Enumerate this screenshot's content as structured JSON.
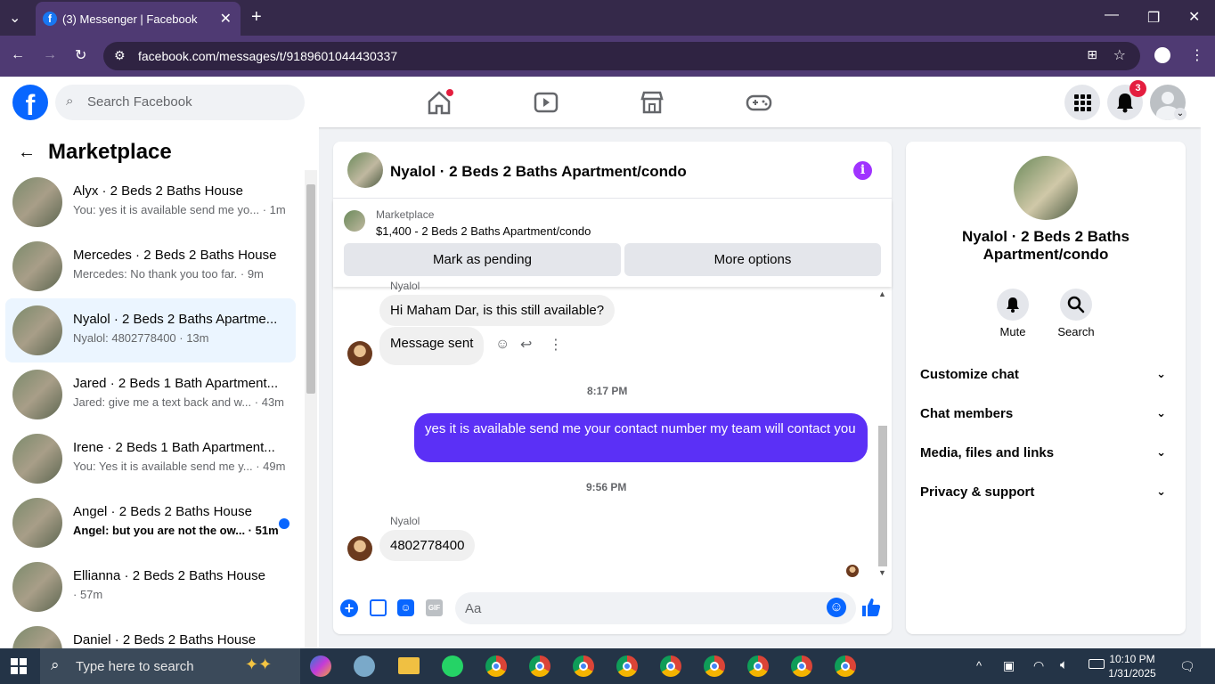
{
  "browser": {
    "tab_title": "(3) Messenger | Facebook",
    "url": "facebook.com/messages/t/9189601044430337"
  },
  "fb_header": {
    "search_placeholder": "Search Facebook",
    "notification_count": "3"
  },
  "sidebar": {
    "title": "Marketplace",
    "conversations": [
      {
        "name": "Alyx · 2 Beds 2 Baths House",
        "preview": "You: yes it is available send me yo... · 1m",
        "selected": false,
        "unread": false
      },
      {
        "name": "Mercedes · 2 Beds 2 Baths House",
        "preview": "Mercedes: No thank you too far. · 9m",
        "selected": false,
        "unread": false
      },
      {
        "name": "Nyalol · 2 Beds 2 Baths Apartme...",
        "preview": "Nyalol: 4802778400 · 13m",
        "selected": true,
        "unread": false
      },
      {
        "name": "Jared · 2 Beds 1 Bath Apartment...",
        "preview": "Jared: give me a text back and w... · 43m",
        "selected": false,
        "unread": false
      },
      {
        "name": "Irene · 2 Beds 1 Bath Apartment...",
        "preview": "You: Yes it is available send me y... · 49m",
        "selected": false,
        "unread": false
      },
      {
        "name": "Angel · 2 Beds 2 Baths House",
        "preview": "Angel: but you are not the ow... · 51m",
        "selected": false,
        "unread": true
      },
      {
        "name": "Ellianna · 2 Beds 2 Baths House",
        "preview": "· 57m",
        "selected": false,
        "unread": false
      },
      {
        "name": "Daniel · 2 Beds 2 Baths House",
        "preview": "",
        "selected": false,
        "unread": false
      }
    ]
  },
  "chat": {
    "title": "Nyalol · 2 Beds 2 Baths Apartment/condo",
    "marketplace_label": "Marketplace",
    "listing": "$1,400 - 2 Beds 2 Baths Apartment/condo",
    "mark_pending_label": "Mark as pending",
    "more_options_label": "More options",
    "partial_sender": "Nyalol",
    "msg1": "Hi Maham Dar, is this still available?",
    "msg2": "Message sent",
    "time1": "8:17 PM",
    "my_msg": "yes it is available send me your contact  number my team  will contact you",
    "time2": "9:56 PM",
    "sender2": "Nyalol",
    "msg3": "4802778400",
    "input_placeholder": "Aa"
  },
  "details": {
    "name": "Nyalol · 2 Beds 2 Baths Apartment/condo",
    "mute_label": "Mute",
    "search_label": "Search",
    "sections": [
      "Customize chat",
      "Chat members",
      "Media, files and links",
      "Privacy & support"
    ]
  },
  "taskbar": {
    "search_placeholder": "Type here to search",
    "time": "10:10 PM",
    "date": "1/31/2025"
  },
  "colors": {
    "brand": "#0866ff",
    "my_bubble": "#5b30f6",
    "info": "#a033ff"
  }
}
